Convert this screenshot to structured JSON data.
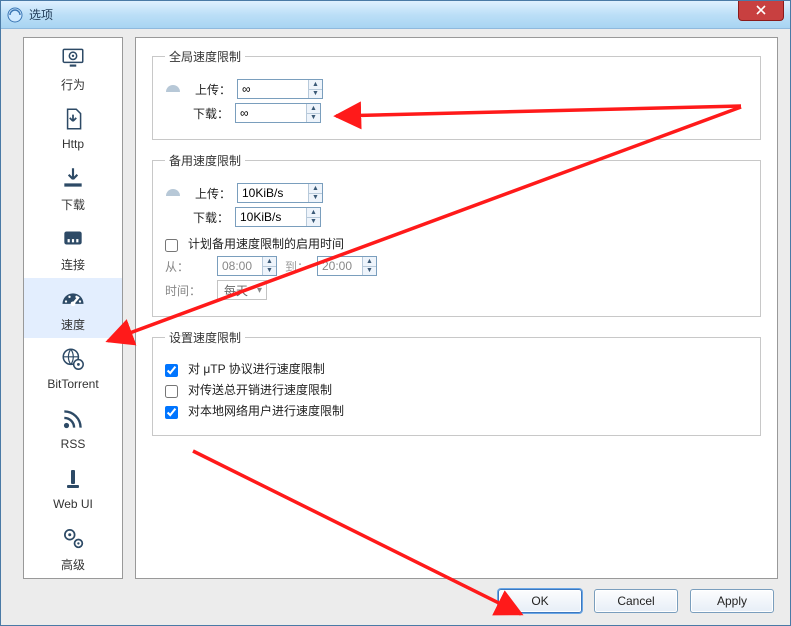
{
  "window": {
    "title": "选项"
  },
  "sidebar": {
    "items": [
      {
        "key": "behavior",
        "label": "行为"
      },
      {
        "key": "http",
        "label": "Http"
      },
      {
        "key": "download",
        "label": "下载"
      },
      {
        "key": "connection",
        "label": "连接"
      },
      {
        "key": "speed",
        "label": "速度"
      },
      {
        "key": "bittorrent",
        "label": "BitTorrent"
      },
      {
        "key": "rss",
        "label": "RSS"
      },
      {
        "key": "webui",
        "label": "Web UI"
      },
      {
        "key": "advanced",
        "label": "高级"
      }
    ],
    "selected_index": 4
  },
  "panel": {
    "global": {
      "legend": "全局速度限制",
      "upload_label": "上传：",
      "download_label": "下载：",
      "upload_value": "∞",
      "download_value": "∞"
    },
    "alt": {
      "legend": "备用速度限制",
      "upload_label": "上传：",
      "download_label": "下载：",
      "upload_value": "10KiB/s",
      "download_value": "10KiB/s",
      "schedule_checkbox_label": "计划备用速度限制的启用时间",
      "schedule_checked": false,
      "from_label": "从：",
      "from_value": "08:00",
      "to_label": "到：",
      "to_value": "20:00",
      "days_label": "时间：",
      "days_value": "每天"
    },
    "settings": {
      "legend": "设置速度限制",
      "opts": [
        {
          "label": "对 μTP 协议进行速度限制",
          "checked": true
        },
        {
          "label": "对传送总开销进行速度限制",
          "checked": false
        },
        {
          "label": "对本地网络用户进行速度限制",
          "checked": true
        }
      ]
    }
  },
  "buttons": {
    "ok": "OK",
    "cancel": "Cancel",
    "apply": "Apply"
  }
}
